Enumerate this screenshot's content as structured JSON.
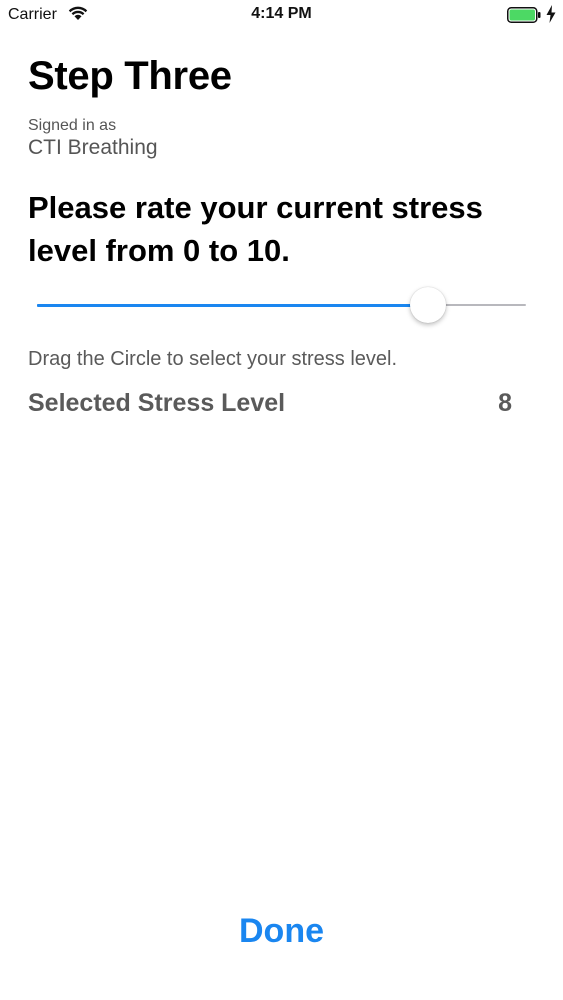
{
  "status_bar": {
    "carrier": "Carrier",
    "time": "4:14 PM",
    "battery_color": "#4cd964"
  },
  "header": {
    "title": "Step Three",
    "signed_in_label": "Signed in as",
    "signed_in_user": "CTI Breathing"
  },
  "question": {
    "text": "Please rate your current stress level from 0 to 10."
  },
  "slider": {
    "min": 0,
    "max": 10,
    "value": 8,
    "fill_color": "#1a86f0",
    "track_color": "#b8b8bd"
  },
  "instructions": "Drag the Circle to select your stress level.",
  "stress": {
    "label": "Selected Stress Level",
    "value": "8"
  },
  "footer": {
    "done_label": "Done",
    "accent": "#1a86f0"
  }
}
